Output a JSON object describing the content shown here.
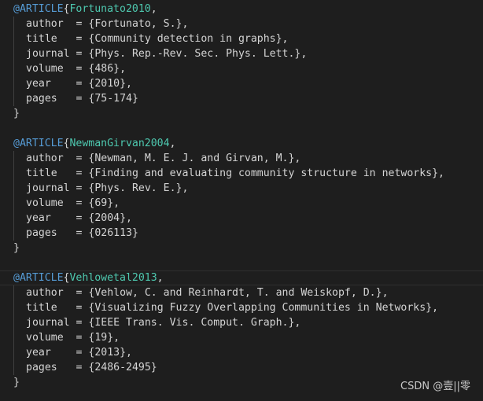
{
  "colors": {
    "background": "#1e1e1e",
    "keyword": "#569cd6",
    "citation_key": "#4ec9b0",
    "text": "#d4d4d4"
  },
  "entries": [
    {
      "type": "@ARTICLE",
      "key": "Fortunato2010",
      "fields": [
        {
          "name": "author",
          "sep": "  = ",
          "value": "{Fortunato, S.},"
        },
        {
          "name": "title",
          "sep": "   = ",
          "value": "{Community detection in graphs},"
        },
        {
          "name": "journal",
          "sep": " = ",
          "value": "{Phys. Rep.-Rev. Sec. Phys. Lett.},"
        },
        {
          "name": "volume",
          "sep": "  = ",
          "value": "{486},"
        },
        {
          "name": "year",
          "sep": "    = ",
          "value": "{2010},"
        },
        {
          "name": "pages",
          "sep": "   = ",
          "value": "{75-174}"
        }
      ],
      "close": "}"
    },
    {
      "type": "@ARTICLE",
      "key": "NewmanGirvan2004",
      "fields": [
        {
          "name": "author",
          "sep": "  = ",
          "value": "{Newman, M. E. J. and Girvan, M.},"
        },
        {
          "name": "title",
          "sep": "   = ",
          "value": "{Finding and evaluating community structure in networks},"
        },
        {
          "name": "journal",
          "sep": " = ",
          "value": "{Phys. Rev. E.},"
        },
        {
          "name": "volume",
          "sep": "  = ",
          "value": "{69},"
        },
        {
          "name": "year",
          "sep": "    = ",
          "value": "{2004},"
        },
        {
          "name": "pages",
          "sep": "   = ",
          "value": "{026113}"
        }
      ],
      "close": "}"
    },
    {
      "type": "@ARTICLE",
      "key": "Vehlowetal2013",
      "fields": [
        {
          "name": "author",
          "sep": "  = ",
          "value": "{Vehlow, C. and Reinhardt, T. and Weiskopf, D.},"
        },
        {
          "name": "title",
          "sep": "   = ",
          "value": "{Visualizing Fuzzy Overlapping Communities in Networks},"
        },
        {
          "name": "journal",
          "sep": " = ",
          "value": "{IEEE Trans. Vis. Comput. Graph.},"
        },
        {
          "name": "volume",
          "sep": "  = ",
          "value": "{19},"
        },
        {
          "name": "year",
          "sep": "    = ",
          "value": "{2013},"
        },
        {
          "name": "pages",
          "sep": "   = ",
          "value": "{2486-2495}"
        }
      ],
      "close": "}"
    }
  ],
  "watermark": "CSDN @壹||零"
}
